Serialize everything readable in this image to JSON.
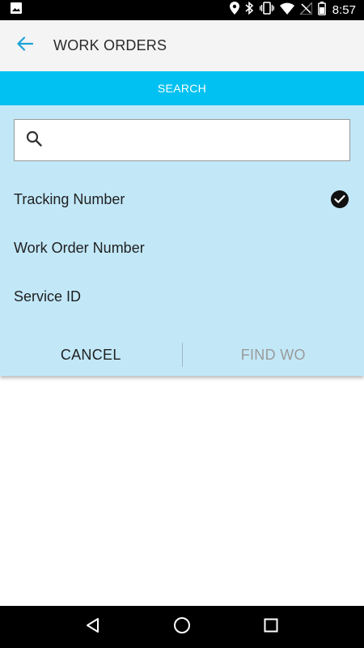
{
  "status_bar": {
    "time": "8:57",
    "icons": [
      "image-icon",
      "location-icon",
      "bluetooth-icon",
      "vibrate-icon",
      "wifi-icon",
      "no-signal-icon",
      "battery-icon"
    ]
  },
  "app_bar": {
    "title": "WORK ORDERS",
    "back_icon": "arrow-left-icon"
  },
  "search_tab": {
    "label": "SEARCH"
  },
  "search": {
    "value": "",
    "placeholder": ""
  },
  "options": [
    {
      "label": "Tracking Number",
      "selected": true
    },
    {
      "label": "Work Order Number",
      "selected": false
    },
    {
      "label": "Service ID",
      "selected": false
    }
  ],
  "actions": {
    "cancel_label": "CANCEL",
    "find_label": "FIND WO"
  },
  "nav_bar": {
    "icons": [
      "back-triangle-icon",
      "home-circle-icon",
      "recents-square-icon"
    ]
  },
  "colors": {
    "accent": "#00c1f1",
    "panel": "#c2e8f8",
    "app_bar": "#f4f4f4",
    "disabled_text": "#9a9a9a"
  }
}
